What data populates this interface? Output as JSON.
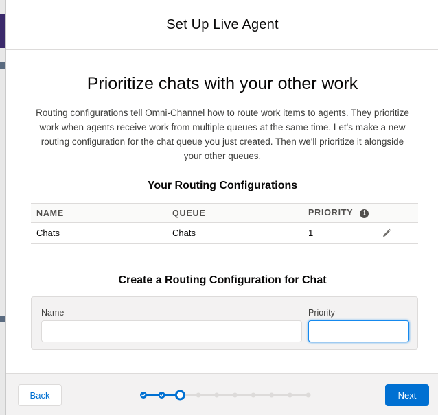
{
  "modal": {
    "header_title": "Set Up Live Agent"
  },
  "intro": {
    "title": "Prioritize chats with your other work",
    "description": "Routing configurations tell Omni-Channel how to route work items to agents. They prioritize work when agents receive work from multiple queues at the same time. Let's make a new routing configuration for the chat queue you just created. Then we'll prioritize it alongside your other queues."
  },
  "configurations": {
    "title": "Your Routing Configurations",
    "columns": {
      "name": "NAME",
      "queue": "QUEUE",
      "priority": "PRIORITY"
    },
    "rows": [
      {
        "name": "Chats",
        "queue": "Chats",
        "priority": "1"
      }
    ],
    "icons": {
      "priority_info": "info-icon",
      "row_edit": "pencil-icon"
    }
  },
  "create_form": {
    "title": "Create a Routing Configuration for Chat",
    "name_label": "Name",
    "name_value": "",
    "priority_label": "Priority",
    "priority_value": ""
  },
  "footer": {
    "back_label": "Back",
    "next_label": "Next",
    "progress": {
      "total_steps": 10,
      "current_step": 3,
      "completed_steps": 2
    }
  },
  "colors": {
    "brand": "#0070d2",
    "progress_inactive": "#dddbda",
    "header_text": "#080707"
  }
}
